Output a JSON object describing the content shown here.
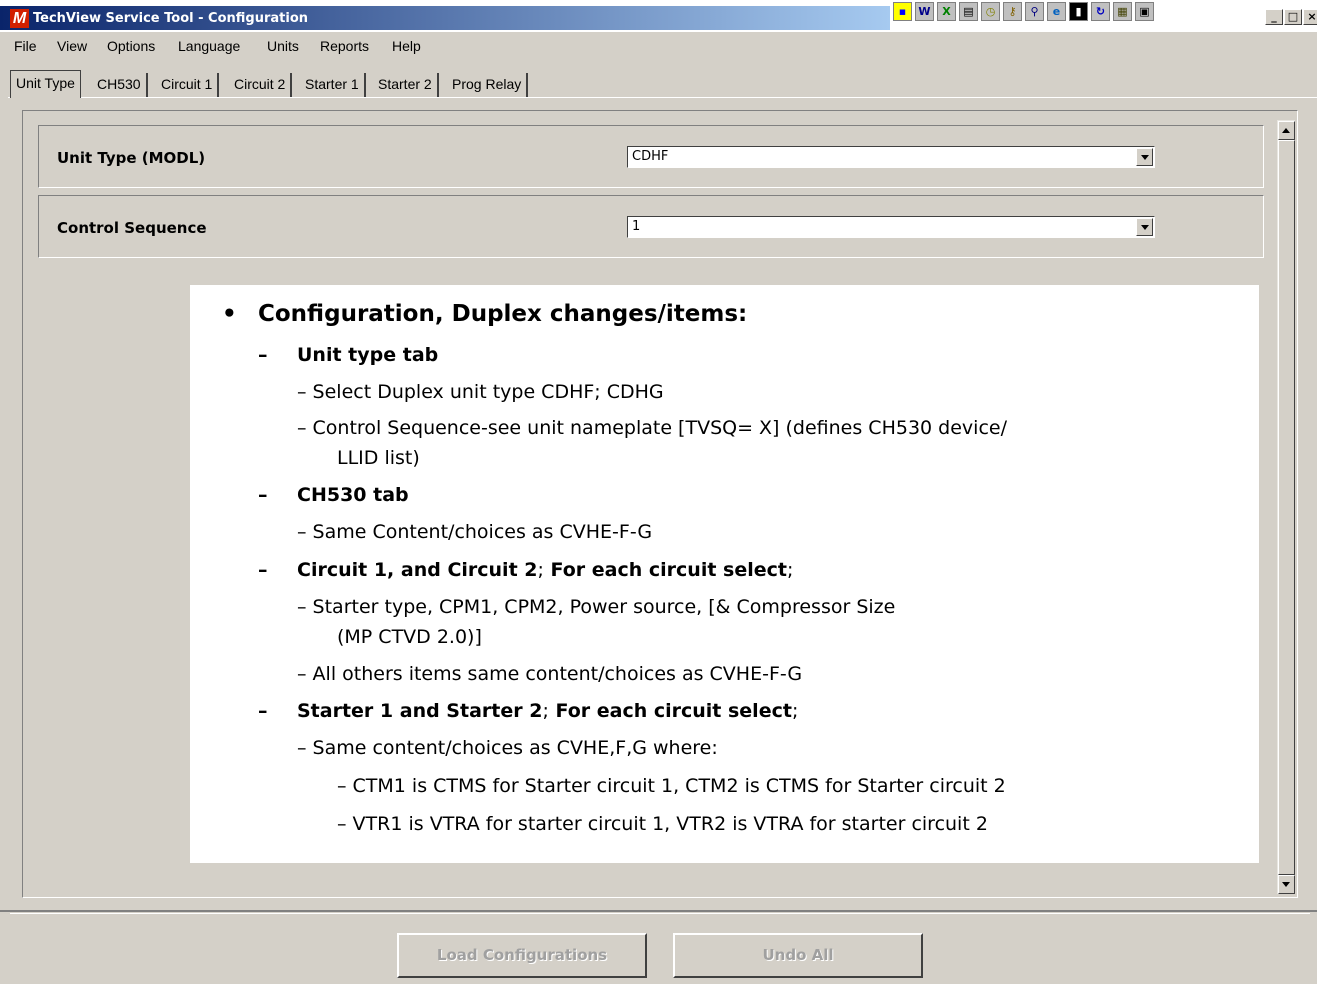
{
  "window": {
    "title": "TechView Service Tool - Configuration",
    "app_icon_letter": "M"
  },
  "tray_icons": [
    "color-icon",
    "word-icon",
    "excel-icon",
    "app-icon",
    "clock-icon",
    "key-icon",
    "search-icon",
    "ie-icon",
    "cmd-icon",
    "refresh-icon",
    "notes-icon",
    "window-icon"
  ],
  "window_controls": {
    "minimize": "_",
    "maximize": "□",
    "close": "×"
  },
  "menu": [
    "File",
    "View",
    "Options",
    "Language",
    "Units",
    "Reports",
    "Help"
  ],
  "tabs": [
    "Unit Type",
    "CH530",
    "Circuit 1",
    "Circuit 2",
    "Starter 1",
    "Starter 2",
    "Prog Relay"
  ],
  "active_tab": "Unit Type",
  "fields": {
    "unit_type": {
      "label": "Unit Type (MODL)",
      "value": "CDHF"
    },
    "control_sequence": {
      "label": "Control Sequence",
      "value": "1"
    }
  },
  "overlay": {
    "bullet": "•",
    "dash": "–",
    "heading": "Configuration, Duplex changes/items:",
    "unit_type_tab": "Unit type tab",
    "ut_item1": "– Select Duplex unit type CDHF; CDHG",
    "ut_item2a": "– Control Sequence-see unit nameplate [TVSQ= X] (defines CH530 device/",
    "ut_item2b": "LLID list)",
    "ch530_tab": "CH530 tab",
    "ch_item1": "– Same Content/choices as CVHE-F-G",
    "circuit_head": "Circuit 1, and Circuit 2",
    "circuit_sep": ";",
    "circuit_tail": "For each circuit select",
    "circuit_end": ";",
    "ci_item1a": "– Starter type, CPM1, CPM2, Power source, [& Compressor Size",
    "ci_item1b": "(MP CTVD 2.0)]",
    "ci_item2": "– All others items same content/choices as CVHE-F-G",
    "starter_head": "Starter 1 and Starter 2",
    "starter_sep": ";",
    "starter_tail": "For each circuit select",
    "starter_end": ";",
    "st_item1": "– Same content/choices as CVHE,F,G where:",
    "st_sub1": "– CTM1 is CTMS for Starter circuit 1, CTM2 is CTMS for Starter circuit 2",
    "st_sub2": "– VTR1 is VTRA for starter circuit 1, VTR2 is VTRA for starter circuit 2"
  },
  "buttons": {
    "load": "Load Configurations",
    "undo": "Undo All"
  }
}
